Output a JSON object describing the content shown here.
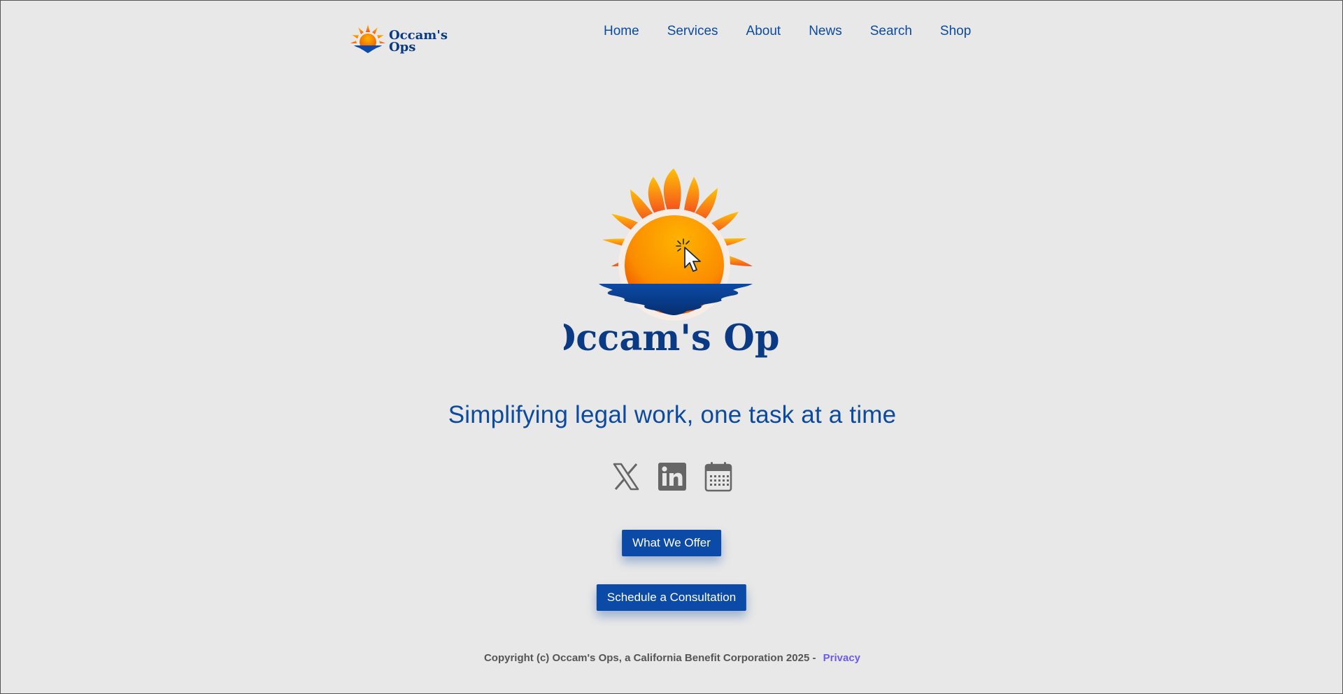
{
  "header": {
    "logo_line1": "Occam's",
    "logo_line2": "Ops"
  },
  "nav": {
    "items": [
      "Home",
      "Services",
      "About",
      "News",
      "Search",
      "Shop"
    ]
  },
  "hero": {
    "logo_text": "Occam's Ops",
    "tagline": "Simplifying legal work, one task at a time"
  },
  "social": {
    "icons": [
      "x-twitter-icon",
      "linkedin-icon",
      "calendar-icon"
    ]
  },
  "buttons": {
    "offer": "What We Offer",
    "consult": "Schedule a Consultation"
  },
  "footer": {
    "copyright": "Copyright (c) Occam's Ops, a California Benefit Corporation 2025 -",
    "privacy": "Privacy"
  },
  "colors": {
    "brand_blue": "#0b4aa6",
    "nav_text": "#0b4a9e",
    "background": "#e8e8e8",
    "sun_orange": "#f57c00",
    "privacy_link": "#6a5be8"
  }
}
